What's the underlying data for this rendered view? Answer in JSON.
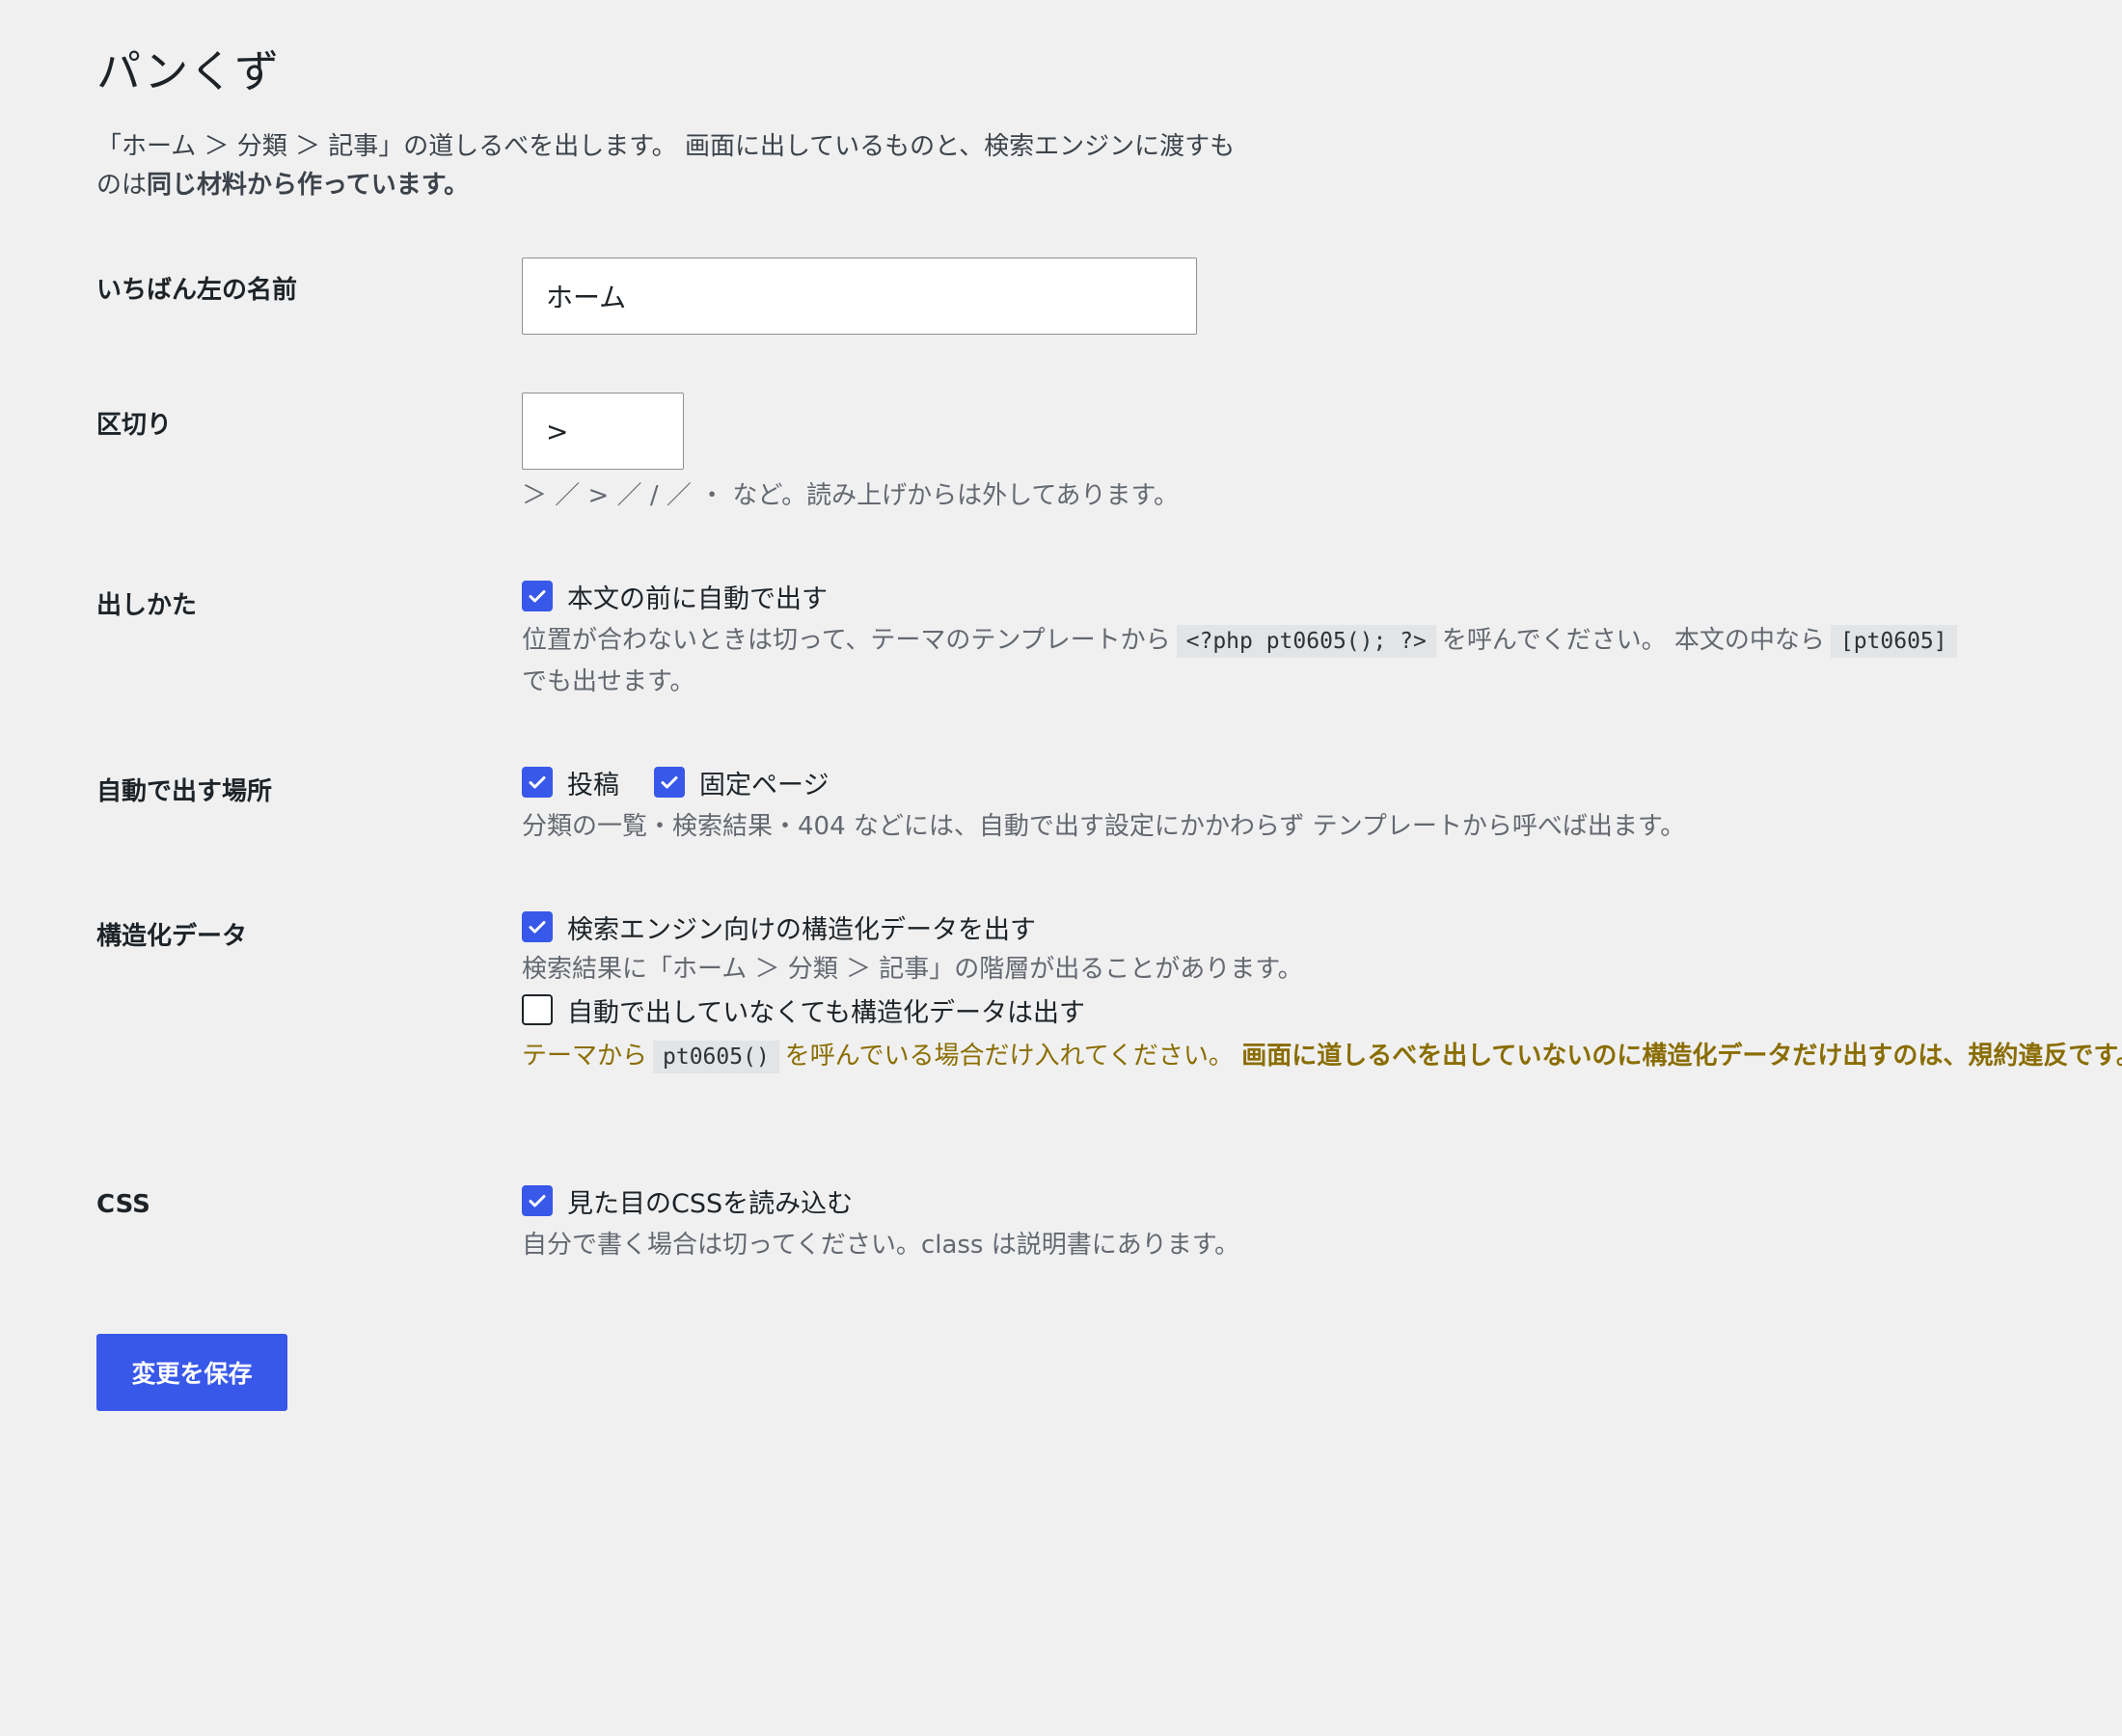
{
  "page": {
    "title": "パンくず",
    "intro_text": "「ホーム ＞ 分類 ＞ 記事」の道しるべを出します。 画面に出しているものと、検索エンジンに渡すものは",
    "intro_strong": "同じ材料から作っています。"
  },
  "fields": {
    "home_label": {
      "label": "いちばん左の名前",
      "value": "ホーム"
    },
    "separator": {
      "label": "区切り",
      "value": ">",
      "description": "＞ ／ > ／ / ／ ・ など。読み上げからは外してあります。"
    },
    "display": {
      "label": "出しかた",
      "checkbox_label": "本文の前に自動で出す",
      "checked": true,
      "desc_part1": "位置が合わないときは切って、テーマのテンプレートから",
      "desc_code1": "<?php pt0605(); ?>",
      "desc_part2": "を呼んでください。 本文の中なら",
      "desc_code2": "[pt0605]",
      "desc_part3": "でも出せます。"
    },
    "auto_locations": {
      "label": "自動で出す場所",
      "options": [
        {
          "label": "投稿",
          "checked": true
        },
        {
          "label": "固定ページ",
          "checked": true
        }
      ],
      "description": "分類の一覧・検索結果・404 などには、自動で出す設定にかかわらず テンプレートから呼べば出ます。"
    },
    "structured_data": {
      "label": "構造化データ",
      "option1_label": "検索エンジン向けの構造化データを出す",
      "option1_checked": true,
      "option1_desc": "検索結果に「ホーム ＞ 分類 ＞ 記事」の階層が出ることがあります。",
      "option2_label": "自動で出していなくても構造化データは出す",
      "option2_checked": false,
      "warn_part1": "テーマから",
      "warn_code": "pt0605()",
      "warn_part2": "を呼んでいる場合だけ入れてください。",
      "warn_strong": "画面に道しるべを出していないのに構造化データだけ出すのは、規約違反です。"
    },
    "css": {
      "label": "CSS",
      "checkbox_label": "見た目のCSSを読み込む",
      "checked": true,
      "description": "自分で書く場合は切ってください。class は説明書にあります。"
    }
  },
  "actions": {
    "save_label": "変更を保存"
  },
  "colors": {
    "accent": "#3858e9",
    "background": "#f0f0f1",
    "warning": "#8a6d00"
  }
}
